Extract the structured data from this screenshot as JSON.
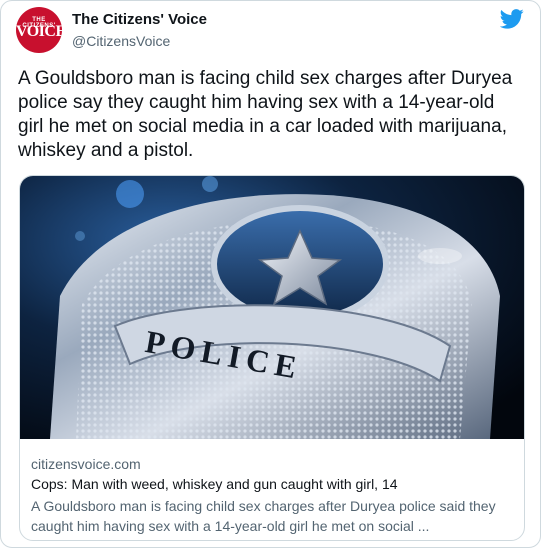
{
  "account": {
    "name": "The Citizens' Voice",
    "handle": "@CitizensVoice",
    "logo_top": "THE CITIZENS'",
    "logo_main": "VOICE"
  },
  "tweet": {
    "text": "A Gouldsboro man is facing child sex charges after Duryea police say they caught him having sex with a 14-year-old girl he met on social media in a car loaded with marijuana, whiskey and a pistol."
  },
  "card": {
    "image_text": "POLICE",
    "domain": "citizensvoice.com",
    "title": "Cops: Man with weed, whiskey and gun caught with girl, 14",
    "description": "A Gouldsboro man is facing child sex charges after Duryea police said they caught him having sex with a 14-year-old girl he met on social ..."
  },
  "icons": {
    "brand": "twitter-bird-icon",
    "brand_color": "#1d9bf0",
    "logo_color": "#c8102e"
  }
}
